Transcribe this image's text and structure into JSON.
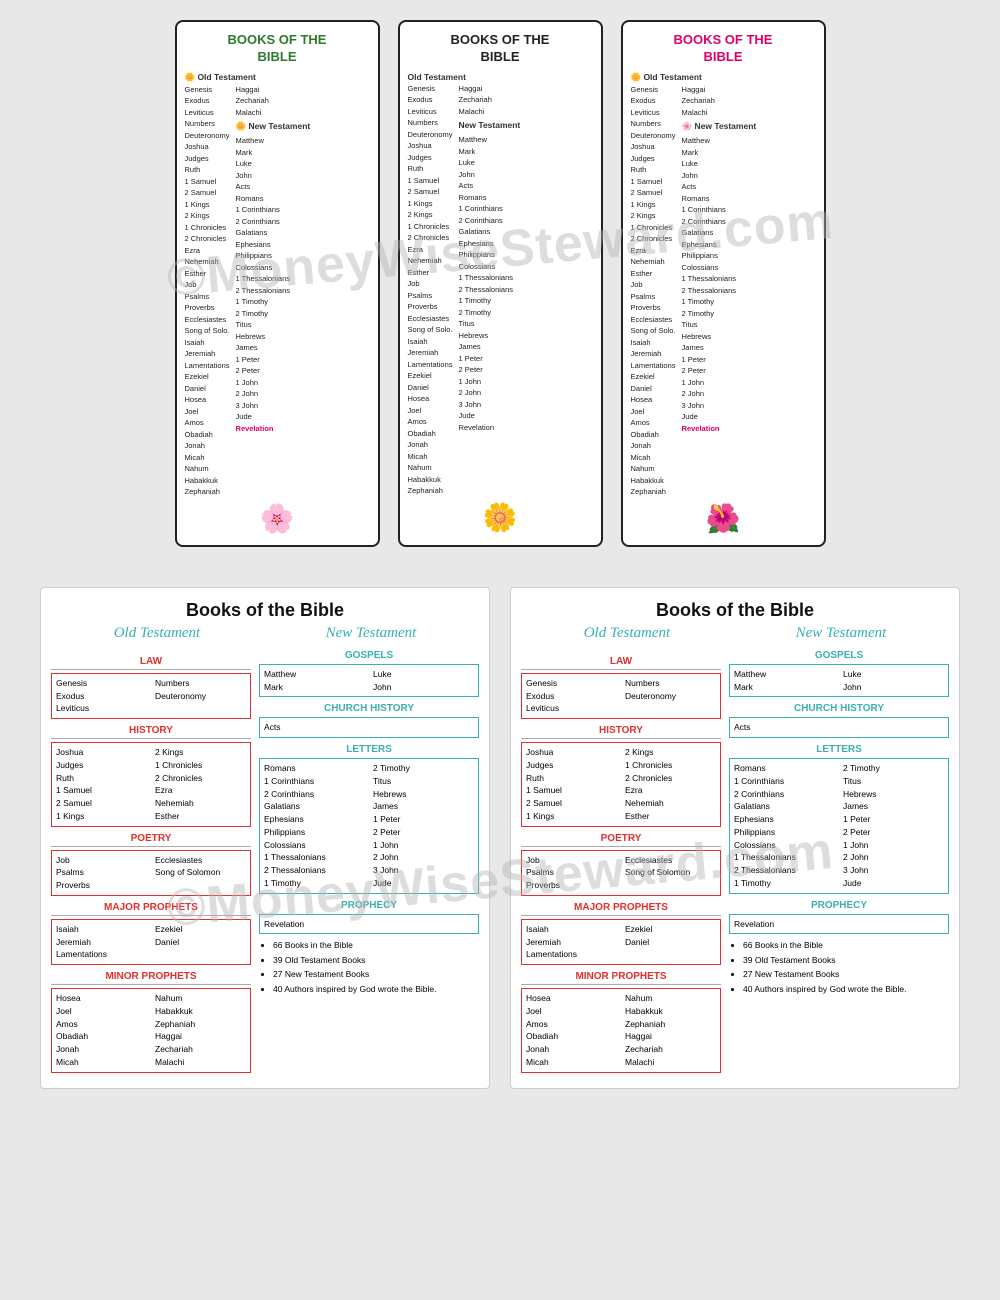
{
  "watermark": {
    "text1": "©MoneyWiseSteward.com",
    "text2": "©MoneyWiseSteward.com"
  },
  "bookmarks": [
    {
      "id": "bm1",
      "titleLine1": "BOOKS OF THE",
      "titleLine2": "BIBLE",
      "color": "green",
      "ot_label": "🌼 Old Testament",
      "nt_label": "🌼 New Testament",
      "ot_col1": [
        "Genesis",
        "Exodus",
        "Leviticus",
        "Numbers",
        "Deuteronomy",
        "Joshua",
        "Judges",
        "Ruth",
        "1 Samuel",
        "2 Samuel",
        "1 Kings",
        "2 Kings",
        "1 Chronicles",
        "2 Chronicles",
        "Ezra",
        "Nehemiah",
        "Esther",
        "Job",
        "Psalms",
        "Proverbs",
        "Ecclesiastes",
        "Song of Solo.",
        "Isaiah",
        "Jeremiah",
        "Lamentations",
        "Ezekiel",
        "Daniel",
        "Hosea",
        "Joel",
        "Amos",
        "Obadiah",
        "Jonah",
        "Micah",
        "Nahum",
        "Habakkuk",
        "Zephaniah"
      ],
      "ot_col2": [
        "Haggai",
        "Zechariah",
        "Malachi"
      ],
      "nt_col1": [
        "Matthew",
        "Mark",
        "Luke",
        "John",
        "Acts",
        "Romans",
        "1 Corinthians",
        "2 Corinthians",
        "Galatians",
        "Ephesians",
        "Philippians",
        "Colossians",
        "1 Thessalonians",
        "2 Thessalonians",
        "1 Timothy",
        "2 Timothy",
        "Titus",
        "Hebrews",
        "James",
        "1 Peter",
        "2 Peter",
        "1 John",
        "2 John",
        "3 John",
        "Jude",
        "Revelation"
      ],
      "flower": "🌸"
    },
    {
      "id": "bm2",
      "titleLine1": "BOOKS OF THE",
      "titleLine2": "BIBLE",
      "color": "black",
      "ot_label": "Old Testament",
      "nt_label": "New Testament",
      "ot_col1": [
        "Genesis",
        "Exodus",
        "Leviticus",
        "Numbers",
        "Deuteronomy",
        "Joshua",
        "Judges",
        "Ruth",
        "1 Samuel",
        "2 Samuel",
        "1 Kings",
        "2 Kings",
        "1 Chronicles",
        "2 Chronicles",
        "Ezra",
        "Nehemiah",
        "Esther",
        "Job",
        "Psalms",
        "Proverbs",
        "Ecclesiastes",
        "Song of Solo.",
        "Isaiah",
        "Jeremiah",
        "Lamentations",
        "Ezekiel",
        "Daniel",
        "Hosea",
        "Joel",
        "Amos",
        "Obadiah",
        "Jonah",
        "Micah",
        "Nahum",
        "Habakkuk",
        "Zephaniah"
      ],
      "ot_col2": [
        "Haggai",
        "Zechariah",
        "Malachi"
      ],
      "nt_col1": [
        "Matthew",
        "Mark",
        "Luke",
        "John",
        "Acts",
        "Romans",
        "1 Corinthians",
        "2 Corinthians",
        "Galatians",
        "Ephesians",
        "Philippians",
        "Colossians",
        "1 Thessalonians",
        "2 Thessalonians",
        "1 Timothy",
        "2 Timothy",
        "Titus",
        "Hebrews",
        "James",
        "1 Peter",
        "2 Peter",
        "1 John",
        "2 John",
        "3 John",
        "Jude",
        "Revelation"
      ],
      "flower": "🌼"
    },
    {
      "id": "bm3",
      "titleLine1": "BOOKS OF THE",
      "titleLine2": "BIBLE",
      "color": "pink",
      "ot_label": "🌼 Old Testament",
      "nt_label": "🌸 New Testament",
      "ot_col1": [
        "Genesis",
        "Exodus",
        "Leviticus",
        "Numbers",
        "Deuteronomy",
        "Joshua",
        "Judges",
        "Ruth",
        "1 Samuel",
        "2 Samuel",
        "1 Kings",
        "2 Kings",
        "1 Chronicles",
        "2 Chronicles",
        "Ezra",
        "Nehemiah",
        "Esther",
        "Job",
        "Psalms",
        "Proverbs",
        "Ecclesiastes",
        "Song of Solo.",
        "Isaiah",
        "Jeremiah",
        "Lamentations",
        "Ezekiel",
        "Daniel",
        "Hosea",
        "Joel",
        "Amos",
        "Obadiah",
        "Jonah",
        "Micah",
        "Nahum",
        "Habakkuk",
        "Zephaniah"
      ],
      "ot_col2": [
        "Haggai",
        "Zechariah",
        "Malachi"
      ],
      "nt_col1": [
        "Matthew",
        "Mark",
        "Luke",
        "John",
        "Acts",
        "Romans",
        "1 Corinthians",
        "2 Corinthians",
        "Galatians",
        "Ephesians",
        "Philippians",
        "Colossians",
        "1 Thessalonians",
        "2 Thessalonians",
        "1 Timothy",
        "2 Timothy",
        "Titus",
        "Hebrews",
        "James",
        "1 Peter",
        "2 Peter",
        "1 John",
        "2 John",
        "3 John",
        "Jude",
        "Revelation"
      ],
      "flower": "🌺"
    }
  ],
  "cards": [
    {
      "title": "Books of the Bible",
      "subtitle_ot": "Old Testament",
      "subtitle_nt": "New Testament",
      "law_heading": "LAW",
      "law_left": [
        "Genesis",
        "Exodus",
        "Leviticus"
      ],
      "law_right": [
        "Numbers",
        "Deuteronomy"
      ],
      "history_heading": "HISTORY",
      "history_left": [
        "Joshua",
        "Judges",
        "Ruth",
        "1 Samuel",
        "2 Samuel",
        "1 Kings"
      ],
      "history_right": [
        "2 Kings",
        "1 Chronicles",
        "2 Chronicles",
        "Ezra",
        "Nehemiah",
        "Esther"
      ],
      "poetry_heading": "POETRY",
      "poetry_left": [
        "Job",
        "Psalms",
        "Proverbs"
      ],
      "poetry_right": [
        "Ecclesiastes",
        "Song of Solomon"
      ],
      "major_heading": "MAJOR PROPHETS",
      "major_left": [
        "Isaiah",
        "Jeremiah",
        "Lamentations"
      ],
      "major_right": [
        "Ezekiel",
        "Daniel"
      ],
      "minor_heading": "MINOR PROPHETS",
      "minor_left": [
        "Hosea",
        "Joel",
        "Amos",
        "Obadiah",
        "Jonah",
        "Micah"
      ],
      "minor_right": [
        "Nahum",
        "Habakkuk",
        "Zephaniah",
        "Haggai",
        "Zechariah",
        "Malachi"
      ],
      "gospels_heading": "GOSPELS",
      "gospels_left": [
        "Matthew",
        "Mark"
      ],
      "gospels_right": [
        "Luke",
        "John"
      ],
      "church_heading": "CHURCH HISTORY",
      "church": [
        "Acts"
      ],
      "letters_heading": "LETTERS",
      "letters_left": [
        "Romans",
        "1 Corinthians",
        "2 Corinthians",
        "Galatians",
        "Ephesians",
        "Philippians",
        "Colossians",
        "1 Thessalonians",
        "2 Thessalonians",
        "1 Timothy"
      ],
      "letters_right": [
        "2 Timothy",
        "Titus",
        "Hebrews",
        "James",
        "1 Peter",
        "2 Peter",
        "1 John",
        "2 John",
        "3 John",
        "Jude"
      ],
      "prophecy_heading": "PROPHECY",
      "prophecy": [
        "Revelation"
      ],
      "facts": [
        "66 Books in the Bible",
        "39 Old Testament Books",
        "27 New Testament Books",
        "40 Authors inspired by God wrote the Bible."
      ]
    },
    {
      "title": "Books of the Bible",
      "subtitle_ot": "Old Testament",
      "subtitle_nt": "New Testament",
      "law_heading": "LAW",
      "law_left": [
        "Genesis",
        "Exodus",
        "Leviticus"
      ],
      "law_right": [
        "Numbers",
        "Deuteronomy"
      ],
      "history_heading": "HISTORY",
      "history_left": [
        "Joshua",
        "Judges",
        "Ruth",
        "1 Samuel",
        "2 Samuel",
        "1 Kings"
      ],
      "history_right": [
        "2 Kings",
        "1 Chronicles",
        "2 Chronicles",
        "Ezra",
        "Nehemiah",
        "Esther"
      ],
      "poetry_heading": "POETRY",
      "poetry_left": [
        "Job",
        "Psalms",
        "Proverbs"
      ],
      "poetry_right": [
        "Ecclesiastes",
        "Song of Solomon"
      ],
      "major_heading": "MAJOR PROPHETS",
      "major_left": [
        "Isaiah",
        "Jeremiah",
        "Lamentations"
      ],
      "major_right": [
        "Ezekiel",
        "Daniel"
      ],
      "minor_heading": "MINOR PROPHETS",
      "minor_left": [
        "Hosea",
        "Joel",
        "Amos",
        "Obadiah",
        "Jonah",
        "Micah"
      ],
      "minor_right": [
        "Nahum",
        "Habakkuk",
        "Zephaniah",
        "Haggai",
        "Zechariah",
        "Malachi"
      ],
      "gospels_heading": "GOSPELS",
      "gospels_left": [
        "Matthew",
        "Mark"
      ],
      "gospels_right": [
        "Luke",
        "John"
      ],
      "church_heading": "CHURCH HISTORY",
      "church": [
        "Acts"
      ],
      "letters_heading": "LETTERS",
      "letters_left": [
        "Romans",
        "1 Corinthians",
        "2 Corinthians",
        "Galatians",
        "Ephesians",
        "Philippians",
        "Colossians",
        "1 Thessalonians",
        "2 Thessalonians",
        "1 Timothy"
      ],
      "letters_right": [
        "2 Timothy",
        "Titus",
        "Hebrews",
        "James",
        "1 Peter",
        "2 Peter",
        "1 John",
        "2 John",
        "3 John",
        "Jude"
      ],
      "prophecy_heading": "PROPHECY",
      "prophecy": [
        "Revelation"
      ],
      "facts": [
        "66 Books in the Bible",
        "39 Old Testament Books",
        "27 New Testament Books",
        "40 Authors inspired by God wrote the Bible."
      ]
    }
  ]
}
